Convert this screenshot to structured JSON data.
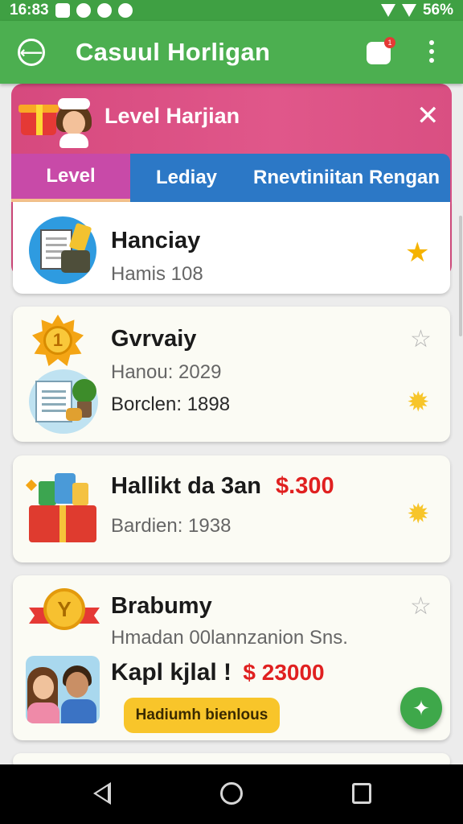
{
  "status_bar": {
    "time": "16:83",
    "battery": "56%"
  },
  "app_bar": {
    "title": "Casuul Horligan",
    "notification_count": "1"
  },
  "panel": {
    "title": "Level Harjian",
    "close_label": "✕"
  },
  "tabs": [
    {
      "label": "Level",
      "active": true
    },
    {
      "label": "Lediay",
      "active": false
    },
    {
      "label": "Rnevtiniitan Rengan",
      "active": false
    }
  ],
  "cards": [
    {
      "title": "Hanciay",
      "line1": "Hamis 108",
      "icon": "documents-icon"
    },
    {
      "title": "Gvrvaiy",
      "line1": "Hanou: 2029",
      "line2": "Borclen: 1898",
      "icon": "medal-icon"
    },
    {
      "title": "Hallikt da 3an",
      "price": "$.300",
      "line1": "Bardien: 1938",
      "icon": "gift-basket-icon"
    },
    {
      "title": "Brabumy",
      "line1": "Hmadan 00lannzanion Sns.",
      "line2": "Kapl kjlal !",
      "price": "$ 23000",
      "button": "Hadiumh bienlous",
      "icon": "ribbon-medal-icon"
    }
  ],
  "colors": {
    "primary": "#4caf50",
    "panel": "#d94f82",
    "tab_blue": "#2c78c6",
    "price": "#e02020",
    "cta": "#f8c52a"
  }
}
